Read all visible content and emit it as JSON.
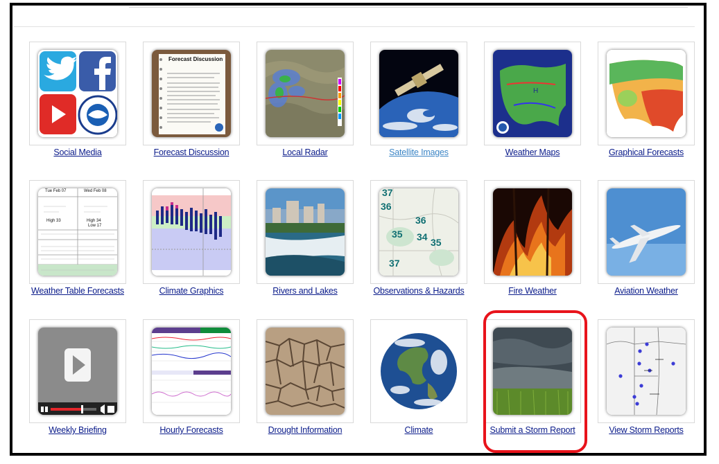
{
  "tiles": [
    {
      "label": "Social Media"
    },
    {
      "label": "Forecast Discussion",
      "thumb_title": "Forecast Discussion"
    },
    {
      "label": "Local Radar"
    },
    {
      "label": "Satellite Images"
    },
    {
      "label": "Weather Maps"
    },
    {
      "label": "Graphical Forecasts"
    },
    {
      "label": "Weather Table Forecasts",
      "thumb_text": [
        "Tue Feb 07",
        "Wed Feb 08",
        "High 33",
        "High 34",
        "Low 17"
      ]
    },
    {
      "label": "Climate Graphics"
    },
    {
      "label": "Rivers and Lakes"
    },
    {
      "label": "Observations & Hazards",
      "thumb_numbers": [
        "37",
        "36",
        "36",
        "35",
        "34",
        "35",
        "37"
      ]
    },
    {
      "label": "Fire Weather"
    },
    {
      "label": "Aviation Weather"
    },
    {
      "label": "Weekly Briefing"
    },
    {
      "label": "Hourly Forecasts"
    },
    {
      "label": "Drought Information"
    },
    {
      "label": "Climate"
    },
    {
      "label": "Submit a Storm Report"
    },
    {
      "label": "View Storm Reports"
    }
  ],
  "colors": {
    "link": "#0a1b8a",
    "visited_link": "#3d86c6",
    "highlight": "#e8131b"
  }
}
